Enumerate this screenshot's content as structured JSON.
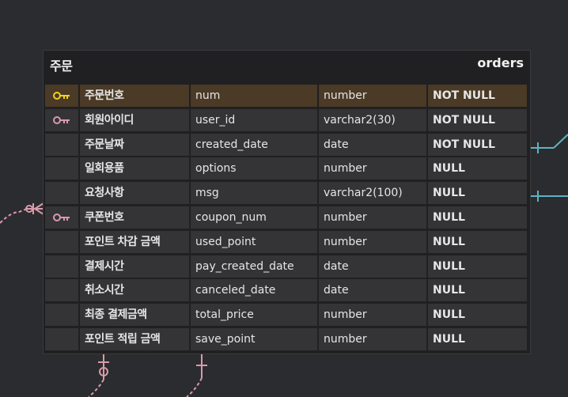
{
  "table": {
    "title_kr": "주문",
    "title_en": "orders",
    "rows": [
      {
        "name_kr": "주문번호",
        "column": "num",
        "type": "number",
        "constraint": "NOT NULL",
        "key": "primary-key-icon",
        "key_color": "#f2d21f"
      },
      {
        "name_kr": "회원아이디",
        "column": "user_id",
        "type": "varchar2(30)",
        "constraint": "NOT NULL",
        "key": "foreign-key-icon",
        "key_color": "#d99aaa"
      },
      {
        "name_kr": "주문날짜",
        "column": "created_date",
        "type": "date",
        "constraint": "NOT NULL",
        "key": ""
      },
      {
        "name_kr": "일회용품",
        "column": "options",
        "type": "number",
        "constraint": "NULL",
        "key": ""
      },
      {
        "name_kr": "요청사항",
        "column": "msg",
        "type": "varchar2(100)",
        "constraint": "NULL",
        "key": ""
      },
      {
        "name_kr": "쿠폰번호",
        "column": "coupon_num",
        "type": "number",
        "constraint": "NULL",
        "key": "foreign-key-icon",
        "key_color": "#d99aaa"
      },
      {
        "name_kr": "포인트 차감 금액",
        "column": "used_point",
        "type": "number",
        "constraint": "NULL",
        "key": ""
      },
      {
        "name_kr": "결제시간",
        "column": "pay_created_date",
        "type": "date",
        "constraint": "NULL",
        "key": ""
      },
      {
        "name_kr": "취소시간",
        "column": "canceled_date",
        "type": "date",
        "constraint": "NULL",
        "key": ""
      },
      {
        "name_kr": "최종 결제금액",
        "column": "total_price",
        "type": "number",
        "constraint": "NULL",
        "key": ""
      },
      {
        "name_kr": "포인트 적립 금액",
        "column": "save_point",
        "type": "number",
        "constraint": "NULL",
        "key": ""
      }
    ]
  },
  "colors": {
    "background": "#2b2c2f",
    "table_bg": "#202022",
    "cell_bg": "#343436",
    "pk_row_bg": "#4a3a26",
    "pink_relation": "#d99aaa",
    "teal_relation": "#5fb3c4"
  }
}
